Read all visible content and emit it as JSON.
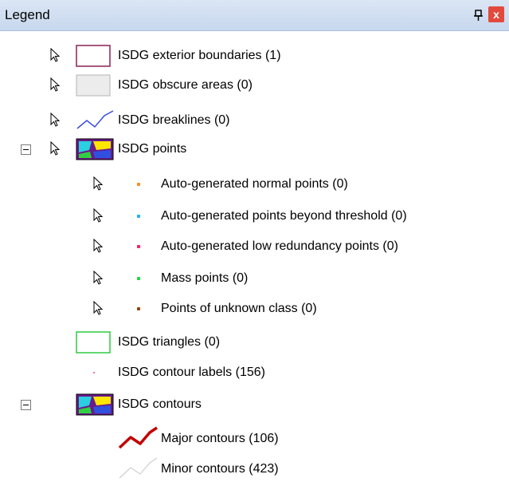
{
  "panel": {
    "title": "Legend",
    "close_glyph": "x",
    "icons": {
      "pin": "pin-icon",
      "close": "close-icon",
      "cursor": "arrow-cursor-icon"
    }
  },
  "items": [
    {
      "label": "ISDG exterior boundaries (1)",
      "symbol": "polygon",
      "stroke": "#8b2252",
      "fill": "#ffffff"
    },
    {
      "label": "ISDG obscure areas (0)",
      "symbol": "polygon",
      "stroke": "#b4b4b4",
      "fill": "#ececec"
    },
    {
      "label": "ISDG breaklines (0)",
      "symbol": "line",
      "stroke": "#3a4fd8"
    },
    {
      "label": "ISDG points",
      "symbol": "group-icon",
      "expanded": true
    },
    {
      "label": "Auto-generated normal points (0)",
      "symbol": "point",
      "color": "#ff8c1a"
    },
    {
      "label": "Auto-generated points beyond threshold (0)",
      "symbol": "point",
      "color": "#1ab0ff"
    },
    {
      "label": "Auto-generated low redundancy points (0)",
      "symbol": "point",
      "color": "#ff1a6e"
    },
    {
      "label": "Mass points (0)",
      "symbol": "point",
      "color": "#1ad93a"
    },
    {
      "label": "Points of unknown class (0)",
      "symbol": "point",
      "color": "#8b4513"
    },
    {
      "label": "ISDG triangles (0)",
      "symbol": "polygon",
      "stroke": "#2ecc40",
      "fill": "#ffffff"
    },
    {
      "label": "ISDG contour labels (156)",
      "symbol": "point",
      "color": "#e05070"
    },
    {
      "label": "ISDG contours",
      "symbol": "group-icon",
      "expanded": true
    },
    {
      "label": "Major contours (106)",
      "symbol": "line",
      "stroke": "#c00000"
    },
    {
      "label": "Minor contours (423)",
      "symbol": "line",
      "stroke": "#cfcfcf"
    }
  ]
}
